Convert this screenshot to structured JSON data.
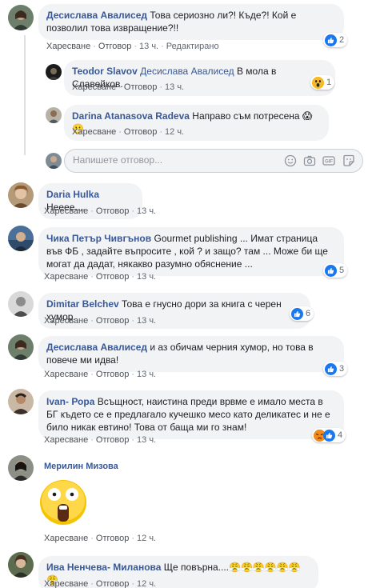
{
  "common": {
    "like": "Харесване",
    "reply": "Отговор",
    "edited": "Редактирано"
  },
  "comments": [
    {
      "author": "Десислава Авалисед",
      "text": "Това сериозно ли?! Къде?! Кой е позволил това извращение?!!",
      "time": "13 ч.",
      "reaction_count": "2"
    },
    {
      "author": "Teodor Slavov",
      "mention": "Десислава Авалисед",
      "text": "В мола в Славейков.",
      "time": "13 ч.",
      "reaction_count": "1"
    },
    {
      "author": "Darina Atanasova Radeva",
      "text": "Направо съм потресена 😱😬",
      "time": "12 ч."
    },
    {
      "author": "Daria Hulka",
      "text": "Неееe....",
      "time": "13 ч."
    },
    {
      "author": "Чика Петър Чивгънов",
      "text": "Gourmet publishing ... Имат страница във ФБ , задайте въпросите , кой ? и защо? там ... Може би ще могат да дадат, някакво разумно обяснение ...",
      "time": "13 ч.",
      "reaction_count": "5"
    },
    {
      "author": "Dimitar Belchev",
      "text": "Това е гнусно дори за книга с черен хумор.",
      "time": "13 ч.",
      "reaction_count": "6"
    },
    {
      "author": "Десислава Авалисед",
      "text": "и аз обичам черния хумор, но това в повече ми идва!",
      "time": "13 ч.",
      "reaction_count": "3"
    },
    {
      "author": "Ivan- Рора",
      "text": "Всъщност, наистина преди врвме е имало места в БГ където се е предлагало кучешко месо като деликатес и не е било никак евтино! Това от баща ми го знам!",
      "time": "13 ч.",
      "reaction_count": "4"
    },
    {
      "author": "Мерилин Мизова",
      "time": "12 ч."
    },
    {
      "author": "Ива Ненчева- Миланова",
      "text": "Ще повърна....😤😤😤😤😤😤😤",
      "time": "12 ч."
    }
  ],
  "reply_box": {
    "placeholder": "Напишете отговор..."
  },
  "icons": {
    "emoji": "smiley-icon",
    "camera": "camera-icon",
    "gif": "gif-icon",
    "sticker": "sticker-icon",
    "like": "like-icon",
    "wow": "wow-icon",
    "angry": "angry-icon"
  },
  "colors": {
    "author": "#385898",
    "bubble": "#f2f3f5",
    "like": "#1877f2",
    "meta": "#606770"
  }
}
